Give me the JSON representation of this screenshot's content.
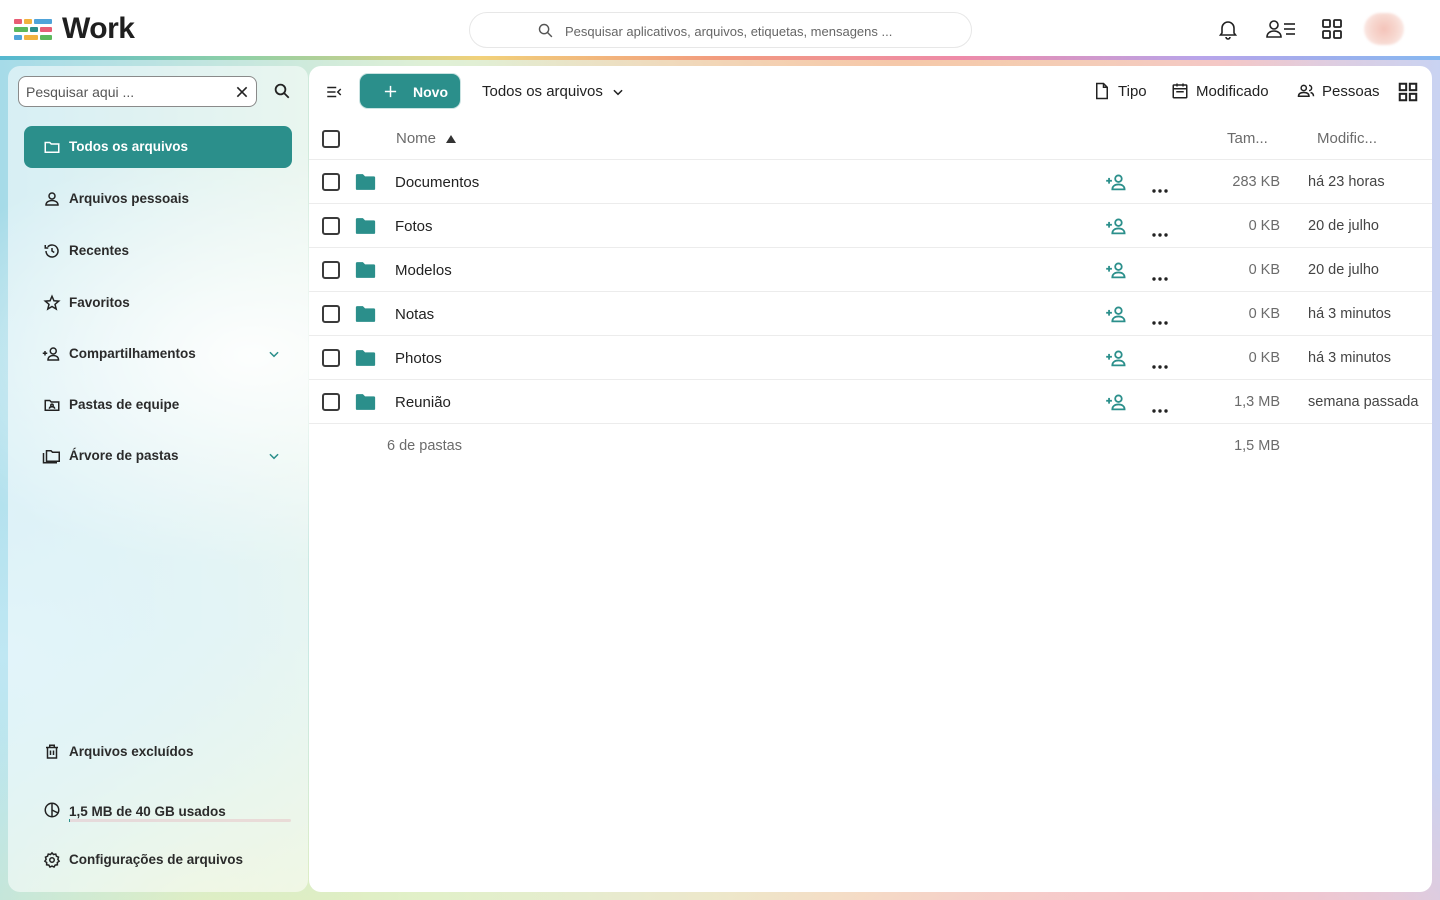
{
  "colors": {
    "accent": "#2b8f8b",
    "folder": "#2b8f8b",
    "text_muted": "#6b6b6b"
  },
  "header": {
    "app_name": "Work",
    "search_placeholder": "Pesquisar aplicativos, arquivos, etiquetas, mensagens ...",
    "icons": [
      "notifications-icon",
      "contacts-icon",
      "apps-grid-icon"
    ]
  },
  "sidebar": {
    "search_placeholder": "Pesquisar aqui ...",
    "items": [
      {
        "label": "Todos os arquivos",
        "icon": "folder-outline-icon",
        "active": true
      },
      {
        "label": "Arquivos pessoais",
        "icon": "user-icon"
      },
      {
        "label": "Recentes",
        "icon": "history-icon"
      },
      {
        "label": "Favoritos",
        "icon": "star-icon"
      },
      {
        "label": "Compartilhamentos",
        "icon": "share-user-icon",
        "expandable": true
      },
      {
        "label": "Pastas de equipe",
        "icon": "team-folder-icon"
      },
      {
        "label": "Árvore de pastas",
        "icon": "folder-tree-icon",
        "expandable": true
      }
    ],
    "trash_label": "Arquivos excluídos",
    "quota_label": "1,5 MB de 40 GB usados",
    "quota_fraction": 4e-05,
    "settings_label": "Configurações de arquivos"
  },
  "toolbar": {
    "new_label": "Novo",
    "breadcrumb": "Todos os arquivos",
    "filters": [
      {
        "label": "Tipo",
        "icon": "file-icon"
      },
      {
        "label": "Modificado",
        "icon": "calendar-icon"
      },
      {
        "label": "Pessoas",
        "icon": "people-icon"
      }
    ]
  },
  "table": {
    "columns": {
      "name": "Nome",
      "size": "Tam...",
      "modified": "Modific..."
    },
    "rows": [
      {
        "name": "Documentos",
        "size": "283 KB",
        "modified": "há 23 horas"
      },
      {
        "name": "Fotos",
        "size": "0 KB",
        "modified": "20 de julho"
      },
      {
        "name": "Modelos",
        "size": "0 KB",
        "modified": "20 de julho"
      },
      {
        "name": "Notas",
        "size": "0 KB",
        "modified": "há 3 minutos"
      },
      {
        "name": "Photos",
        "size": "0 KB",
        "modified": "há 3 minutos"
      },
      {
        "name": "Reunião",
        "size": "1,3 MB",
        "modified": "semana passada"
      }
    ],
    "summary_count": "6 de pastas",
    "summary_size": "1,5 MB"
  }
}
